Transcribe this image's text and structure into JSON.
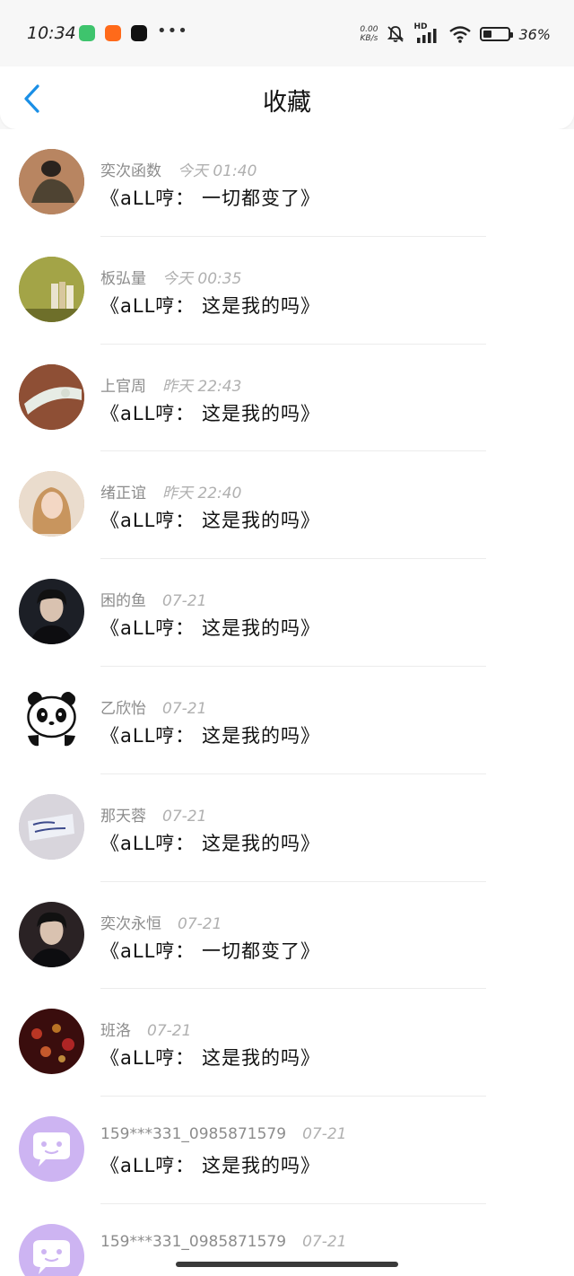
{
  "status_bar": {
    "time": "10:34",
    "apps": [
      "wechat-icon",
      "taobao-icon",
      "tiktok-icon"
    ],
    "more": "•••",
    "net_speed_value": "0.00",
    "net_speed_unit": "KB/s",
    "network": "HD",
    "battery_percent": "36%",
    "battery_level": 0.36
  },
  "header": {
    "back_icon": "chevron-left-icon",
    "title": "收藏"
  },
  "colors": {
    "accent": "#1a8fe6",
    "name_text": "#8c8c8c",
    "time_text": "#b0b0b0",
    "message_text": "#111111",
    "divider": "#ececec"
  },
  "items": [
    {
      "name": "奕次函数",
      "time": "今天 01:40",
      "message": "《aLL哼： 一切都变了》",
      "avatar_color": "#8a6a4e"
    },
    {
      "name": "板弘量",
      "time": "今天 00:35",
      "message": "《aLL哼： 这是我的吗》",
      "avatar_color": "#9aa04a"
    },
    {
      "name": "上官周",
      "time": "昨天 22:43",
      "message": "《aLL哼： 这是我的吗》",
      "avatar_color": "#9b5a3c"
    },
    {
      "name": "绪正谊",
      "time": "昨天 22:40",
      "message": "《aLL哼： 这是我的吗》",
      "avatar_color": "#d8b28a"
    },
    {
      "name": "困的鱼",
      "time": "07-21",
      "message": "《aLL哼： 这是我的吗》",
      "avatar_color": "#1c1f26"
    },
    {
      "name": "乙欣怡",
      "time": "07-21",
      "message": "《aLL哼： 这是我的吗》",
      "avatar_color": "#ffffff"
    },
    {
      "name": "那天蓉",
      "time": "07-21",
      "message": "《aLL哼： 这是我的吗》",
      "avatar_color": "#c9c4cf"
    },
    {
      "name": "奕次永恒",
      "time": "07-21",
      "message": "《aLL哼： 一切都变了》",
      "avatar_color": "#2a2224"
    },
    {
      "name": "班洛",
      "time": "07-21",
      "message": "《aLL哼： 这是我的吗》",
      "avatar_color": "#3a0d0d"
    },
    {
      "name": "159***331_0985871579",
      "time": "07-21",
      "message": "《aLL哼： 这是我的吗》",
      "avatar_color": "#cdb4f2"
    },
    {
      "name": "159***331_0985871579",
      "time": "07-21",
      "message": "",
      "avatar_color": "#cdb4f2"
    }
  ]
}
